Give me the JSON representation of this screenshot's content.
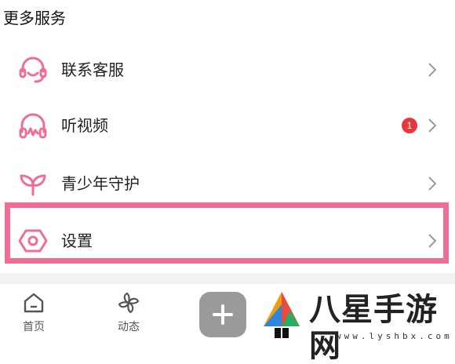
{
  "section": {
    "title": "更多服务"
  },
  "menu": [
    {
      "label": "联系客服",
      "icon": "headset-icon"
    },
    {
      "label": "听视频",
      "icon": "headphones-icon",
      "badge": "1"
    },
    {
      "label": "青少年守护",
      "icon": "sprout-icon"
    },
    {
      "label": "设置",
      "icon": "settings-hexagon-icon"
    }
  ],
  "tabbar": {
    "tabs": [
      {
        "label": "首页",
        "icon": "home-icon"
      },
      {
        "label": "动态",
        "icon": "pinwheel-icon"
      }
    ],
    "add_button": "+"
  },
  "watermark": {
    "text": "八星手游网",
    "url": "www.lyshbx.com"
  },
  "colors": {
    "accent": "#ee6f93",
    "badge": "#e8363c",
    "chevron": "#9a9a9a",
    "add_button": "#9a9a9a"
  }
}
